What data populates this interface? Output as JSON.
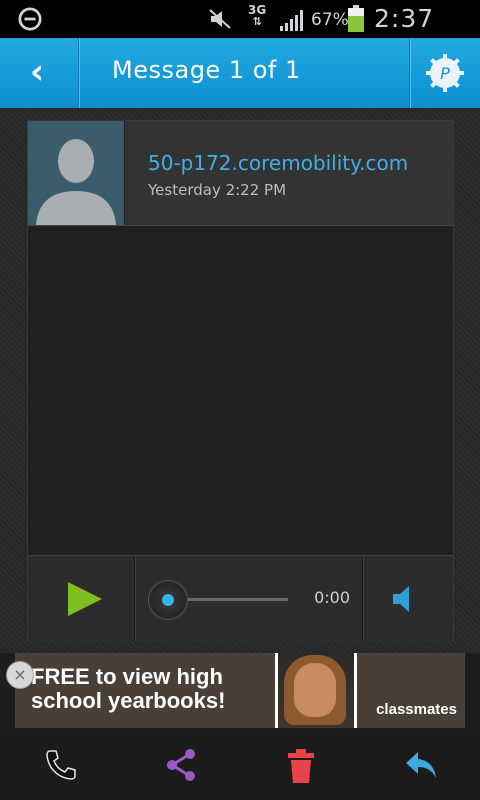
{
  "status_bar": {
    "network_type": "3G",
    "battery_percent": "67%",
    "time": "2:37 PM",
    "icons": [
      "do-not-disturb-icon",
      "mute-icon",
      "data-arrows-icon",
      "signal-icon",
      "battery-icon"
    ]
  },
  "header": {
    "title": "Message 1 of 1",
    "back_icon": "back-chevron-icon",
    "menu_icon": "settings-gear-icon"
  },
  "message": {
    "sender": "50-p172.coremobility.com",
    "timestamp": "Yesterday 2:22 PM",
    "avatar_icon": "contact-silhouette-icon"
  },
  "player": {
    "duration": "0:00",
    "progress": 0,
    "play_icon": "play-icon",
    "volume_icon": "speaker-icon"
  },
  "ad": {
    "headline": "FREE to view high school yearbooks!",
    "brand": "classmates",
    "close_icon": "close-icon"
  },
  "bottom_bar": {
    "buttons": [
      "phone-icon",
      "share-icon",
      "delete-icon",
      "reply-icon"
    ]
  },
  "colors": {
    "accent_blue": "#1ea1dc",
    "play_green": "#7fbf1f",
    "share_purple": "#9b59c8",
    "delete_red": "#e8434a",
    "reply_blue": "#3fa9e0"
  }
}
